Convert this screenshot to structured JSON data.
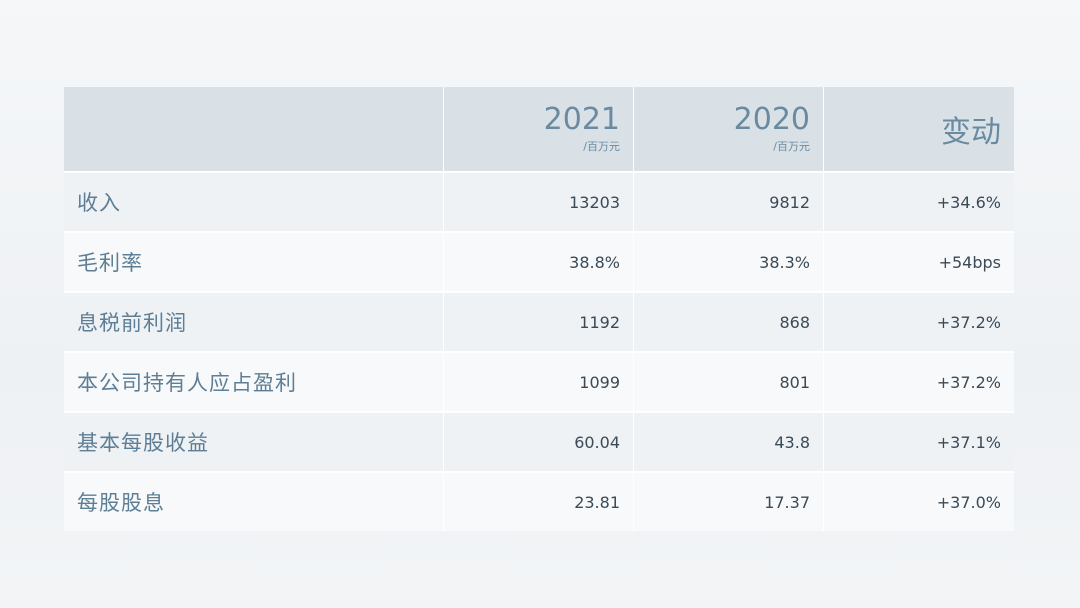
{
  "header": {
    "col1": {
      "year": "2021",
      "unit": "/百万元"
    },
    "col2": {
      "year": "2020",
      "unit": "/百万元"
    },
    "col3": {
      "title": "变动"
    }
  },
  "rows": [
    {
      "label": "收入",
      "v2021": "13203",
      "v2020": "9812",
      "change": "+34.6%"
    },
    {
      "label": "毛利率",
      "v2021": "38.8%",
      "v2020": "38.3%",
      "change": "+54bps"
    },
    {
      "label": "息税前利润",
      "v2021": "1192",
      "v2020": "868",
      "change": "+37.2%"
    },
    {
      "label": "本公司持有人应占盈利",
      "v2021": "1099",
      "v2020": "801",
      "change": "+37.2%"
    },
    {
      "label": "基本每股收益",
      "v2021": "60.04",
      "v2020": "43.8",
      "change": "+37.1%"
    },
    {
      "label": "每股股息",
      "v2021": "23.81",
      "v2020": "17.37",
      "change": "+37.0%"
    }
  ]
}
